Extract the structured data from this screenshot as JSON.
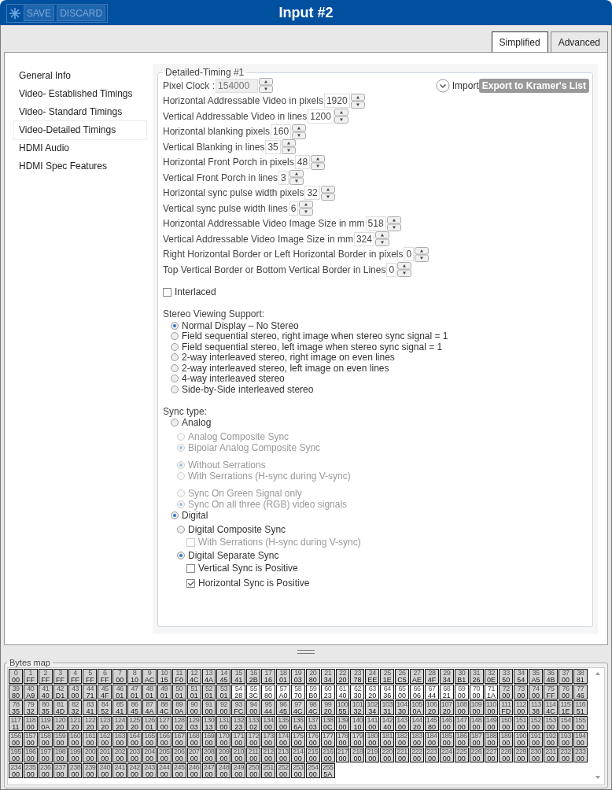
{
  "window": {
    "title": "Input #2",
    "toolbar": [
      {
        "label": "SAVE",
        "disabled": true
      },
      {
        "label": "DISCARD",
        "disabled": true
      }
    ]
  },
  "tabs": [
    {
      "label": "Simplified",
      "selected": true
    },
    {
      "label": "Advanced",
      "selected": false
    }
  ],
  "sidebar": {
    "items": [
      {
        "label": "General Info",
        "selected": false
      },
      {
        "label": "Video- Established Timings",
        "selected": false
      },
      {
        "label": "Video- Standard Timings",
        "selected": false
      },
      {
        "label": "Video-Detailed Timings",
        "selected": true
      },
      {
        "label": "HDMI Audio",
        "selected": false
      },
      {
        "label": "HDMI Spec Features",
        "selected": false
      }
    ]
  },
  "timing": {
    "legend": "Detailed-Timing #1",
    "import_label": "Import",
    "export_button": {
      "label": "Export to Kramer's List",
      "disabled": true
    },
    "fields": [
      {
        "label": "Pixel Clock :",
        "value": "154000",
        "disabled": true
      },
      {
        "label": "Horizontal Addressable Video in pixels",
        "value": "1920",
        "disabled": false
      },
      {
        "label": "Vertical Addressable Video in lines",
        "value": "1200",
        "disabled": false
      },
      {
        "label": "Horizontal blanking pixels",
        "value": "160",
        "disabled": false
      },
      {
        "label": "Vertical Blanking in lines",
        "value": "35",
        "disabled": false
      },
      {
        "label": "Horizontal Front Porch in pixels",
        "value": "48",
        "disabled": false
      },
      {
        "label": "Vertical Front Porch in lines",
        "value": "3",
        "disabled": false
      },
      {
        "label": "Horizontal sync pulse width pixels",
        "value": "32",
        "disabled": false
      },
      {
        "label": "Vertical sync pulse width lines",
        "value": "6",
        "disabled": false
      },
      {
        "label": "Horizontal Addressable Video Image Size in mm",
        "value": "518",
        "disabled": false
      },
      {
        "label": "Vertical Addressable Video Image Size in mm",
        "value": "324",
        "disabled": false
      },
      {
        "label": "Right Horizontal Border or Left Horizontal Border in pixels",
        "value": "0",
        "disabled": false
      },
      {
        "label": "Top Vertical Border or Bottom Vertical Border in Lines",
        "value": "0",
        "disabled": false
      }
    ],
    "interlaced": {
      "label": "Interlaced",
      "checked": false
    },
    "stereo": {
      "label": "Stereo Viewing Support:",
      "options": [
        {
          "label": "Normal Display – No Stereo",
          "selected": true
        },
        {
          "label": "Field sequential stereo, right image when stereo sync signal = 1",
          "selected": false
        },
        {
          "label": "Field sequential stereo, left image when stereo sync signal = 1",
          "selected": false
        },
        {
          "label": "2-way interleaved stereo, right image on even lines",
          "selected": false
        },
        {
          "label": "2-way interleaved stereo, left image on even lines",
          "selected": false
        },
        {
          "label": "4-way interleaved stereo",
          "selected": false
        },
        {
          "label": "Side-by-Side interleaved stereo",
          "selected": false
        }
      ]
    },
    "sync_type": {
      "label": "Sync type:",
      "options": [
        {
          "label": "Analog",
          "selected": false,
          "groups": [
            [
              {
                "label": "Analog Composite Sync",
                "selected": false,
                "disabled": true
              },
              {
                "label": "Bipolar Analog Composite Sync",
                "selected": true,
                "disabled": true
              }
            ],
            [
              {
                "label": "Without Serrations",
                "selected": true,
                "disabled": true
              },
              {
                "label": "With Serrations (H-sync during V-sync)",
                "selected": false,
                "disabled": true
              }
            ],
            [
              {
                "label": "Sync On Green Signal only",
                "selected": false,
                "disabled": true
              },
              {
                "label": "Sync On all three (RGB) video signals",
                "selected": true,
                "disabled": true
              }
            ]
          ]
        },
        {
          "label": "Digital",
          "selected": true,
          "groups": [
            [
              {
                "label": "Digital Composite Sync",
                "selected": false,
                "disabled": false,
                "children": [
                  {
                    "label": "With Serrations (H-sync during V-sync)",
                    "checked": false,
                    "disabled": true
                  }
                ]
              },
              {
                "label": "Digital Separate Sync",
                "selected": true,
                "disabled": false,
                "children": [
                  {
                    "label": "Vertical Sync is Positive",
                    "checked": false,
                    "disabled": false
                  },
                  {
                    "label": "Horizontal Sync is Positive",
                    "checked": true,
                    "disabled": false
                  }
                ]
              }
            ]
          ]
        }
      ]
    }
  },
  "bytes_map": {
    "legend": "Bytes map",
    "bytes": [
      {
        "i": "0",
        "v": "00",
        "selected": false
      },
      {
        "i": "1",
        "v": "FF",
        "selected": false
      },
      {
        "i": "2",
        "v": "FF",
        "selected": false
      },
      {
        "i": "3",
        "v": "FF",
        "selected": false
      },
      {
        "i": "4",
        "v": "FF",
        "selected": false
      },
      {
        "i": "5",
        "v": "FF",
        "selected": false
      },
      {
        "i": "6",
        "v": "FF",
        "selected": false
      },
      {
        "i": "7",
        "v": "00",
        "selected": false
      },
      {
        "i": "8",
        "v": "10",
        "selected": false
      },
      {
        "i": "9",
        "v": "AC",
        "selected": false
      },
      {
        "i": "10",
        "v": "15",
        "selected": false
      },
      {
        "i": "11",
        "v": "F0",
        "selected": false
      },
      {
        "i": "12",
        "v": "4C",
        "selected": false
      },
      {
        "i": "13",
        "v": "4A",
        "selected": false
      },
      {
        "i": "14",
        "v": "45",
        "selected": false
      },
      {
        "i": "15",
        "v": "41",
        "selected": false
      },
      {
        "i": "16",
        "v": "2B",
        "selected": false
      },
      {
        "i": "17",
        "v": "16",
        "selected": false
      },
      {
        "i": "18",
        "v": "01",
        "selected": false
      },
      {
        "i": "19",
        "v": "03",
        "selected": false
      },
      {
        "i": "20",
        "v": "80",
        "selected": false
      },
      {
        "i": "21",
        "v": "34",
        "selected": false
      },
      {
        "i": "22",
        "v": "20",
        "selected": false
      },
      {
        "i": "23",
        "v": "78",
        "selected": false
      },
      {
        "i": "24",
        "v": "EE",
        "selected": false
      },
      {
        "i": "25",
        "v": "1E",
        "selected": false
      },
      {
        "i": "26",
        "v": "C5",
        "selected": false
      },
      {
        "i": "27",
        "v": "AE",
        "selected": false
      },
      {
        "i": "28",
        "v": "4F",
        "selected": false
      },
      {
        "i": "29",
        "v": "34",
        "selected": false
      },
      {
        "i": "30",
        "v": "B1",
        "selected": false
      },
      {
        "i": "31",
        "v": "26",
        "selected": false
      },
      {
        "i": "32",
        "v": "0E",
        "selected": false
      },
      {
        "i": "33",
        "v": "50",
        "selected": false
      },
      {
        "i": "34",
        "v": "54",
        "selected": false
      },
      {
        "i": "35",
        "v": "A5",
        "selected": false
      },
      {
        "i": "36",
        "v": "4B",
        "selected": false
      },
      {
        "i": "37",
        "v": "00",
        "selected": false
      },
      {
        "i": "38",
        "v": "81",
        "selected": false
      },
      {
        "i": "39",
        "v": "80",
        "selected": false
      },
      {
        "i": "40",
        "v": "A9",
        "selected": false
      },
      {
        "i": "41",
        "v": "40",
        "selected": false
      },
      {
        "i": "42",
        "v": "D1",
        "selected": false
      },
      {
        "i": "43",
        "v": "00",
        "selected": false
      },
      {
        "i": "44",
        "v": "71",
        "selected": false
      },
      {
        "i": "45",
        "v": "4F",
        "selected": false
      },
      {
        "i": "46",
        "v": "01",
        "selected": false
      },
      {
        "i": "47",
        "v": "01",
        "selected": false
      },
      {
        "i": "48",
        "v": "01",
        "selected": false
      },
      {
        "i": "49",
        "v": "01",
        "selected": false
      },
      {
        "i": "50",
        "v": "01",
        "selected": false
      },
      {
        "i": "51",
        "v": "01",
        "selected": false
      },
      {
        "i": "52",
        "v": "01",
        "selected": false
      },
      {
        "i": "53",
        "v": "01",
        "selected": false
      },
      {
        "i": "54",
        "v": "28",
        "selected": true
      },
      {
        "i": "55",
        "v": "3C",
        "selected": true
      },
      {
        "i": "56",
        "v": "80",
        "selected": true
      },
      {
        "i": "57",
        "v": "A0",
        "selected": true
      },
      {
        "i": "58",
        "v": "70",
        "selected": true
      },
      {
        "i": "59",
        "v": "B0",
        "selected": true
      },
      {
        "i": "60",
        "v": "23",
        "selected": true
      },
      {
        "i": "61",
        "v": "40",
        "selected": true
      },
      {
        "i": "62",
        "v": "30",
        "selected": true
      },
      {
        "i": "63",
        "v": "20",
        "selected": true
      },
      {
        "i": "64",
        "v": "36",
        "selected": true
      },
      {
        "i": "65",
        "v": "00",
        "selected": true
      },
      {
        "i": "66",
        "v": "06",
        "selected": true
      },
      {
        "i": "67",
        "v": "44",
        "selected": true
      },
      {
        "i": "68",
        "v": "21",
        "selected": true
      },
      {
        "i": "69",
        "v": "00",
        "selected": true
      },
      {
        "i": "70",
        "v": "00",
        "selected": true
      },
      {
        "i": "71",
        "v": "1A",
        "selected": true
      },
      {
        "i": "72",
        "v": "00",
        "selected": false
      },
      {
        "i": "73",
        "v": "00",
        "selected": false
      },
      {
        "i": "74",
        "v": "00",
        "selected": false
      },
      {
        "i": "75",
        "v": "FF",
        "selected": false
      },
      {
        "i": "76",
        "v": "00",
        "selected": false
      },
      {
        "i": "77",
        "v": "46",
        "selected": false
      },
      {
        "i": "78",
        "v": "35",
        "selected": false
      },
      {
        "i": "79",
        "v": "32",
        "selected": false
      },
      {
        "i": "80",
        "v": "35",
        "selected": false
      },
      {
        "i": "81",
        "v": "4D",
        "selected": false
      },
      {
        "i": "82",
        "v": "32",
        "selected": false
      },
      {
        "i": "83",
        "v": "41",
        "selected": false
      },
      {
        "i": "84",
        "v": "52",
        "selected": false
      },
      {
        "i": "85",
        "v": "41",
        "selected": false
      },
      {
        "i": "86",
        "v": "45",
        "selected": false
      },
      {
        "i": "87",
        "v": "4A",
        "selected": false
      },
      {
        "i": "88",
        "v": "4C",
        "selected": false
      },
      {
        "i": "89",
        "v": "0A",
        "selected": false
      },
      {
        "i": "90",
        "v": "00",
        "selected": false
      },
      {
        "i": "91",
        "v": "00",
        "selected": false
      },
      {
        "i": "92",
        "v": "00",
        "selected": false
      },
      {
        "i": "93",
        "v": "FC",
        "selected": false
      },
      {
        "i": "94",
        "v": "00",
        "selected": false
      },
      {
        "i": "95",
        "v": "44",
        "selected": false
      },
      {
        "i": "96",
        "v": "45",
        "selected": false
      },
      {
        "i": "97",
        "v": "4C",
        "selected": false
      },
      {
        "i": "98",
        "v": "4C",
        "selected": false
      },
      {
        "i": "99",
        "v": "20",
        "selected": false
      },
      {
        "i": "100",
        "v": "55",
        "selected": false
      },
      {
        "i": "101",
        "v": "32",
        "selected": false
      },
      {
        "i": "102",
        "v": "34",
        "selected": false
      },
      {
        "i": "103",
        "v": "31",
        "selected": false
      },
      {
        "i": "104",
        "v": "30",
        "selected": false
      },
      {
        "i": "105",
        "v": "0A",
        "selected": false
      },
      {
        "i": "106",
        "v": "20",
        "selected": false
      },
      {
        "i": "107",
        "v": "20",
        "selected": false
      },
      {
        "i": "108",
        "v": "00",
        "selected": false
      },
      {
        "i": "109",
        "v": "00",
        "selected": false
      },
      {
        "i": "110",
        "v": "00",
        "selected": false
      },
      {
        "i": "111",
        "v": "FD",
        "selected": false
      },
      {
        "i": "112",
        "v": "00",
        "selected": false
      },
      {
        "i": "113",
        "v": "38",
        "selected": false
      },
      {
        "i": "114",
        "v": "4C",
        "selected": false
      },
      {
        "i": "115",
        "v": "1E",
        "selected": false
      },
      {
        "i": "116",
        "v": "51",
        "selected": false
      },
      {
        "i": "117",
        "v": "11",
        "selected": false
      },
      {
        "i": "118",
        "v": "00",
        "selected": false
      },
      {
        "i": "119",
        "v": "0A",
        "selected": false
      },
      {
        "i": "120",
        "v": "20",
        "selected": false
      },
      {
        "i": "121",
        "v": "20",
        "selected": false
      },
      {
        "i": "122",
        "v": "20",
        "selected": false
      },
      {
        "i": "123",
        "v": "20",
        "selected": false
      },
      {
        "i": "124",
        "v": "20",
        "selected": false
      },
      {
        "i": "125",
        "v": "20",
        "selected": false
      },
      {
        "i": "126",
        "v": "01",
        "selected": false
      },
      {
        "i": "127",
        "v": "00",
        "selected": false
      },
      {
        "i": "128",
        "v": "02",
        "selected": false
      },
      {
        "i": "129",
        "v": "03",
        "selected": false
      },
      {
        "i": "130",
        "v": "13",
        "selected": false
      },
      {
        "i": "131",
        "v": "00",
        "selected": false
      },
      {
        "i": "132",
        "v": "23",
        "selected": false
      },
      {
        "i": "133",
        "v": "02",
        "selected": false
      },
      {
        "i": "134",
        "v": "00",
        "selected": false
      },
      {
        "i": "135",
        "v": "00",
        "selected": false
      },
      {
        "i": "136",
        "v": "6A",
        "selected": false
      },
      {
        "i": "137",
        "v": "03",
        "selected": false
      },
      {
        "i": "138",
        "v": "0C",
        "selected": false
      },
      {
        "i": "139",
        "v": "00",
        "selected": false
      },
      {
        "i": "140",
        "v": "10",
        "selected": false
      },
      {
        "i": "141",
        "v": "00",
        "selected": false
      },
      {
        "i": "142",
        "v": "40",
        "selected": false
      },
      {
        "i": "143",
        "v": "00",
        "selected": false
      },
      {
        "i": "144",
        "v": "20",
        "selected": false
      },
      {
        "i": "145",
        "v": "80",
        "selected": false
      },
      {
        "i": "146",
        "v": "00",
        "selected": false
      },
      {
        "i": "147",
        "v": "00",
        "selected": false
      },
      {
        "i": "148",
        "v": "00",
        "selected": false
      },
      {
        "i": "149",
        "v": "00",
        "selected": false
      },
      {
        "i": "150",
        "v": "00",
        "selected": false
      },
      {
        "i": "151",
        "v": "00",
        "selected": false
      },
      {
        "i": "152",
        "v": "00",
        "selected": false
      },
      {
        "i": "153",
        "v": "00",
        "selected": false
      },
      {
        "i": "154",
        "v": "00",
        "selected": false
      },
      {
        "i": "155",
        "v": "00",
        "selected": false
      },
      {
        "i": "156",
        "v": "00",
        "selected": false
      },
      {
        "i": "157",
        "v": "00",
        "selected": false
      },
      {
        "i": "158",
        "v": "00",
        "selected": false
      },
      {
        "i": "159",
        "v": "00",
        "selected": false
      },
      {
        "i": "160",
        "v": "00",
        "selected": false
      },
      {
        "i": "161",
        "v": "00",
        "selected": false
      },
      {
        "i": "162",
        "v": "00",
        "selected": false
      },
      {
        "i": "163",
        "v": "00",
        "selected": false
      },
      {
        "i": "164",
        "v": "00",
        "selected": false
      },
      {
        "i": "165",
        "v": "00",
        "selected": false
      },
      {
        "i": "166",
        "v": "00",
        "selected": false
      },
      {
        "i": "167",
        "v": "00",
        "selected": false
      },
      {
        "i": "168",
        "v": "00",
        "selected": false
      },
      {
        "i": "169",
        "v": "00",
        "selected": false
      },
      {
        "i": "170",
        "v": "00",
        "selected": false
      },
      {
        "i": "171",
        "v": "00",
        "selected": false
      },
      {
        "i": "172",
        "v": "00",
        "selected": false
      },
      {
        "i": "173",
        "v": "00",
        "selected": false
      },
      {
        "i": "174",
        "v": "00",
        "selected": false
      },
      {
        "i": "175",
        "v": "00",
        "selected": false
      },
      {
        "i": "176",
        "v": "00",
        "selected": false
      },
      {
        "i": "177",
        "v": "00",
        "selected": false
      },
      {
        "i": "178",
        "v": "00",
        "selected": false
      },
      {
        "i": "179",
        "v": "00",
        "selected": false
      },
      {
        "i": "180",
        "v": "00",
        "selected": false
      },
      {
        "i": "181",
        "v": "00",
        "selected": false
      },
      {
        "i": "182",
        "v": "00",
        "selected": false
      },
      {
        "i": "183",
        "v": "00",
        "selected": false
      },
      {
        "i": "184",
        "v": "00",
        "selected": false
      },
      {
        "i": "185",
        "v": "00",
        "selected": false
      },
      {
        "i": "186",
        "v": "00",
        "selected": false
      },
      {
        "i": "187",
        "v": "00",
        "selected": false
      },
      {
        "i": "188",
        "v": "00",
        "selected": false
      },
      {
        "i": "189",
        "v": "00",
        "selected": false
      },
      {
        "i": "190",
        "v": "00",
        "selected": false
      },
      {
        "i": "191",
        "v": "00",
        "selected": false
      },
      {
        "i": "192",
        "v": "00",
        "selected": false
      },
      {
        "i": "193",
        "v": "00",
        "selected": false
      },
      {
        "i": "194",
        "v": "00",
        "selected": false
      },
      {
        "i": "195",
        "v": "00",
        "selected": false
      },
      {
        "i": "196",
        "v": "00",
        "selected": false
      },
      {
        "i": "197",
        "v": "00",
        "selected": false
      },
      {
        "i": "198",
        "v": "00",
        "selected": false
      },
      {
        "i": "199",
        "v": "00",
        "selected": false
      },
      {
        "i": "200",
        "v": "00",
        "selected": false
      },
      {
        "i": "201",
        "v": "00",
        "selected": false
      },
      {
        "i": "202",
        "v": "00",
        "selected": false
      },
      {
        "i": "203",
        "v": "00",
        "selected": false
      },
      {
        "i": "204",
        "v": "00",
        "selected": false
      },
      {
        "i": "205",
        "v": "00",
        "selected": false
      },
      {
        "i": "206",
        "v": "00",
        "selected": false
      },
      {
        "i": "207",
        "v": "00",
        "selected": false
      },
      {
        "i": "208",
        "v": "00",
        "selected": false
      },
      {
        "i": "209",
        "v": "00",
        "selected": false
      },
      {
        "i": "210",
        "v": "00",
        "selected": false
      },
      {
        "i": "211",
        "v": "00",
        "selected": false
      },
      {
        "i": "212",
        "v": "00",
        "selected": false
      },
      {
        "i": "213",
        "v": "00",
        "selected": false
      },
      {
        "i": "214",
        "v": "00",
        "selected": false
      },
      {
        "i": "215",
        "v": "00",
        "selected": false
      },
      {
        "i": "216",
        "v": "00",
        "selected": false
      },
      {
        "i": "217",
        "v": "00",
        "selected": false
      },
      {
        "i": "218",
        "v": "00",
        "selected": false
      },
      {
        "i": "219",
        "v": "00",
        "selected": false
      },
      {
        "i": "220",
        "v": "00",
        "selected": false
      },
      {
        "i": "221",
        "v": "00",
        "selected": false
      },
      {
        "i": "222",
        "v": "00",
        "selected": false
      },
      {
        "i": "223",
        "v": "00",
        "selected": false
      },
      {
        "i": "224",
        "v": "00",
        "selected": false
      },
      {
        "i": "225",
        "v": "00",
        "selected": false
      },
      {
        "i": "226",
        "v": "00",
        "selected": false
      },
      {
        "i": "227",
        "v": "00",
        "selected": false
      },
      {
        "i": "228",
        "v": "00",
        "selected": false
      },
      {
        "i": "229",
        "v": "00",
        "selected": false
      },
      {
        "i": "230",
        "v": "00",
        "selected": false
      },
      {
        "i": "231",
        "v": "00",
        "selected": false
      },
      {
        "i": "232",
        "v": "00",
        "selected": false
      },
      {
        "i": "233",
        "v": "00",
        "selected": false
      },
      {
        "i": "234",
        "v": "00",
        "selected": false
      },
      {
        "i": "235",
        "v": "00",
        "selected": false
      },
      {
        "i": "236",
        "v": "00",
        "selected": false
      },
      {
        "i": "237",
        "v": "00",
        "selected": false
      },
      {
        "i": "238",
        "v": "00",
        "selected": false
      },
      {
        "i": "239",
        "v": "00",
        "selected": false
      },
      {
        "i": "240",
        "v": "00",
        "selected": false
      },
      {
        "i": "241",
        "v": "00",
        "selected": false
      },
      {
        "i": "242",
        "v": "00",
        "selected": false
      },
      {
        "i": "243",
        "v": "00",
        "selected": false
      },
      {
        "i": "244",
        "v": "00",
        "selected": false
      },
      {
        "i": "245",
        "v": "00",
        "selected": false
      },
      {
        "i": "246",
        "v": "00",
        "selected": false
      },
      {
        "i": "247",
        "v": "00",
        "selected": false
      },
      {
        "i": "248",
        "v": "00",
        "selected": false
      },
      {
        "i": "249",
        "v": "00",
        "selected": false
      },
      {
        "i": "250",
        "v": "00",
        "selected": false
      },
      {
        "i": "251",
        "v": "00",
        "selected": false
      },
      {
        "i": "252",
        "v": "00",
        "selected": false
      },
      {
        "i": "253",
        "v": "00",
        "selected": false
      },
      {
        "i": "254",
        "v": "00",
        "selected": false
      },
      {
        "i": "255",
        "v": "5A",
        "selected": false
      }
    ]
  }
}
